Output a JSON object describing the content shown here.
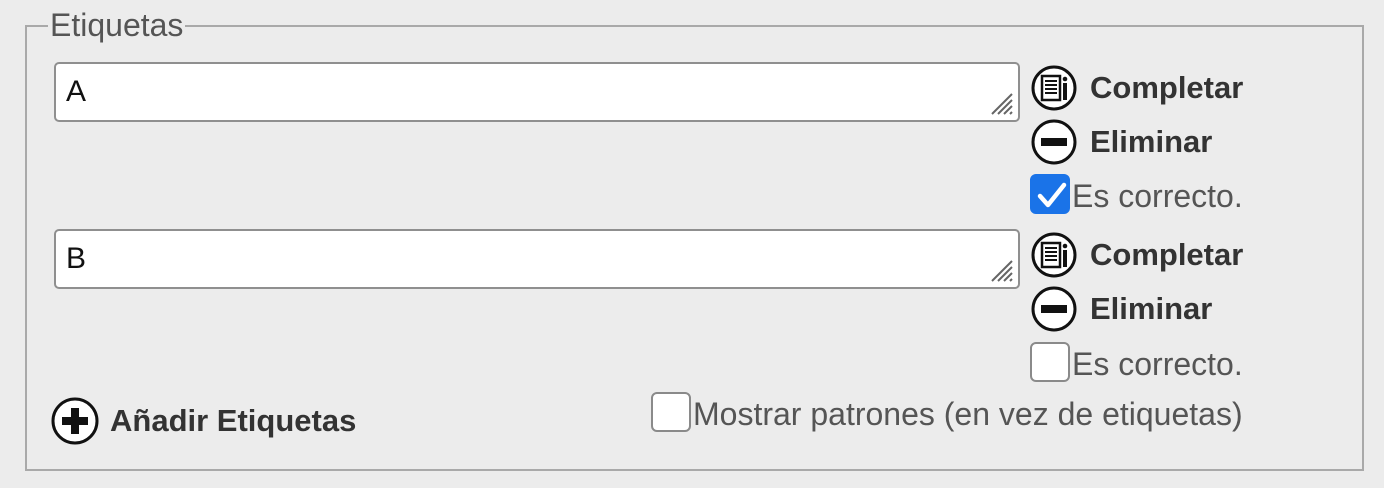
{
  "fieldset": {
    "legend": "Etiquetas"
  },
  "labels": [
    {
      "value": "A",
      "complete_label": "Completar",
      "delete_label": "Eliminar",
      "correct_label": "Es correcto.",
      "correct_checked": true
    },
    {
      "value": "B",
      "complete_label": "Completar",
      "delete_label": "Eliminar",
      "correct_label": "Es correcto.",
      "correct_checked": false
    }
  ],
  "add_button_label": "Añadir Etiquetas",
  "show_patterns": {
    "label": "Mostrar patrones (en vez de etiquetas)",
    "checked": false
  },
  "colors": {
    "checked_accent": "#1a73e8",
    "background": "#ececec",
    "border": "#a9a9a9"
  },
  "icons": {
    "complete": "document-list-icon",
    "delete": "minus-circle-icon",
    "add": "plus-circle-icon"
  }
}
